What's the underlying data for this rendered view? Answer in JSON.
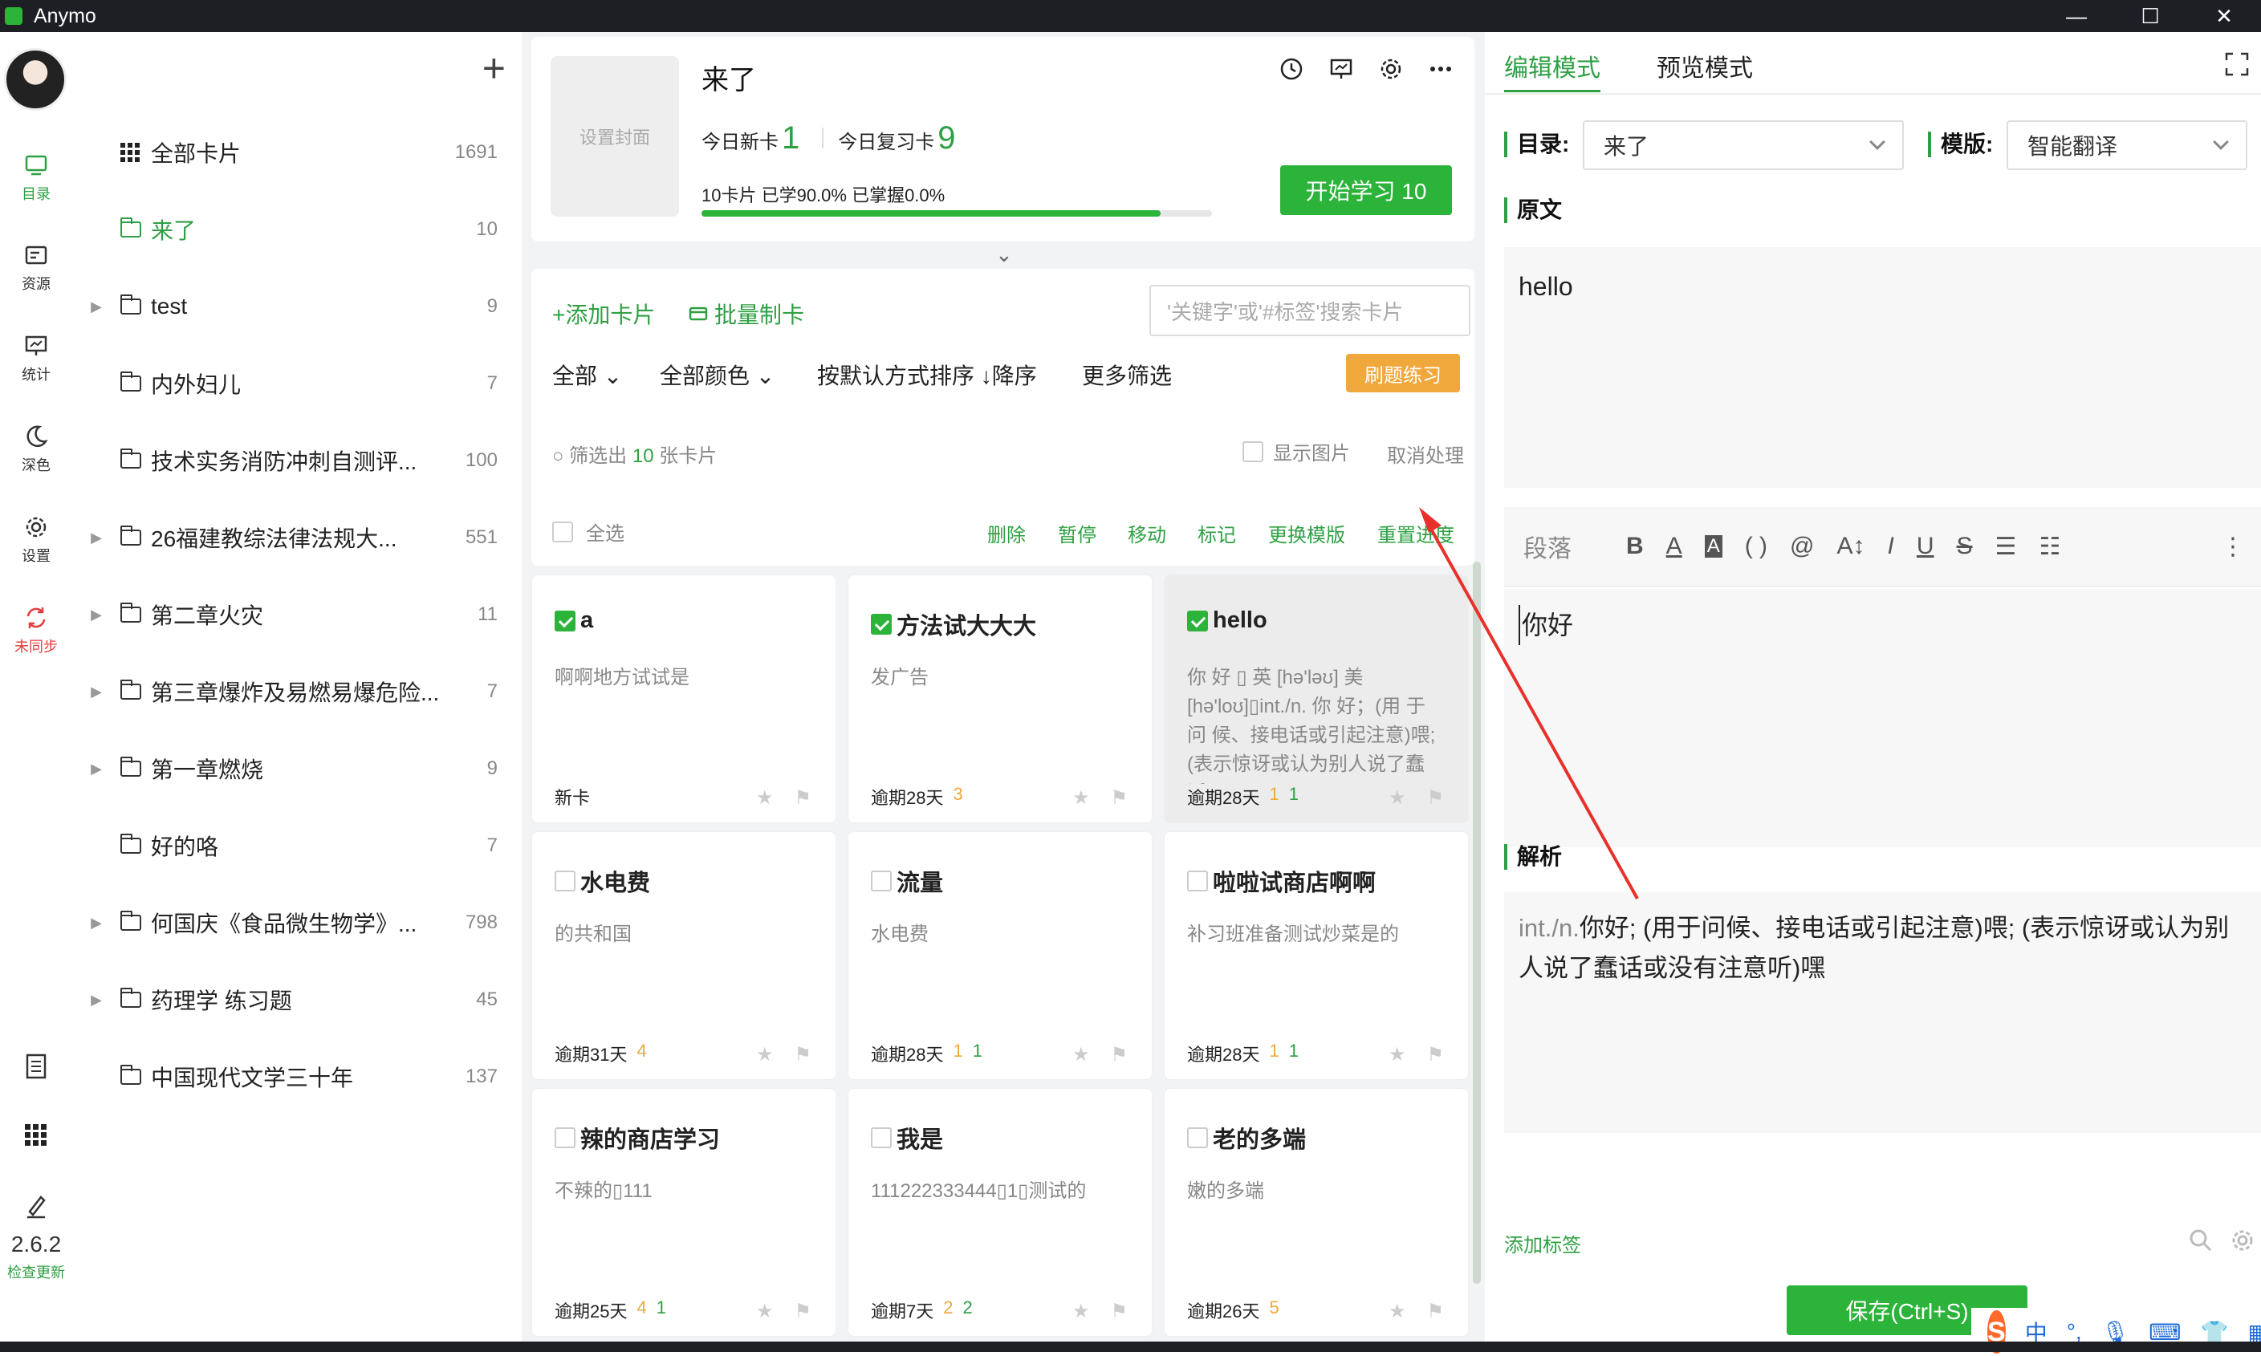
{
  "app": {
    "title": "Anymo"
  },
  "window": {
    "minimize": "—",
    "maximize": "☐",
    "close": "✕"
  },
  "rail": {
    "items": [
      {
        "label": "目录",
        "icon": "monitor-icon"
      },
      {
        "label": "资源",
        "icon": "resource-icon"
      },
      {
        "label": "统计",
        "icon": "chart-icon"
      },
      {
        "label": "深色",
        "icon": "moon-icon"
      },
      {
        "label": "设置",
        "icon": "gear-icon"
      },
      {
        "label": "未同步",
        "icon": "sync-icon"
      }
    ],
    "version": "2.6.2",
    "check_update": "检查更新"
  },
  "directory": {
    "add": "+",
    "all": {
      "name": "全部卡片",
      "count": "1691"
    },
    "items": [
      {
        "name": "来了",
        "count": "10",
        "active": true,
        "arrow": ""
      },
      {
        "name": "test",
        "count": "9",
        "arrow": "▶"
      },
      {
        "name": "内外妇儿",
        "count": "7",
        "arrow": ""
      },
      {
        "name": "技术实务消防冲刺自测评...",
        "count": "100",
        "arrow": ""
      },
      {
        "name": "26福建教综法律法规大...",
        "count": "551",
        "arrow": "▶"
      },
      {
        "name": "第二章火灾",
        "count": "11",
        "arrow": "▶"
      },
      {
        "name": "第三章爆炸及易燃易爆危险...",
        "count": "7",
        "arrow": "▶"
      },
      {
        "name": "第一章燃烧",
        "count": "9",
        "arrow": "▶"
      },
      {
        "name": "好的咯",
        "count": "7",
        "arrow": ""
      },
      {
        "name": "何国庆《食品微生物学》...",
        "count": "798",
        "arrow": "▶"
      },
      {
        "name": "药理学 练习题",
        "count": "45",
        "arrow": "▶"
      },
      {
        "name": "中国现代文学三十年",
        "count": "137",
        "arrow": ""
      }
    ]
  },
  "deck": {
    "cover": "设置封面",
    "title": "来了",
    "new_label": "今日新卡",
    "new_value": "1",
    "review_label": "今日复习卡",
    "review_value": "9",
    "progress_text": "10卡片   已学90.0%   已掌握0.0%",
    "progress": 0.9,
    "study_button": "开始学习 10"
  },
  "filters": {
    "add_card": "+添加卡片",
    "batch": "批量制卡",
    "search_placeholder": "'关键字'或'#标签'搜索卡片",
    "all": "全部",
    "colors": "全部颜色",
    "sort": "按默认方式排序 ↓降序",
    "more": "更多筛选",
    "practice": "刷题练习",
    "filtered_prefix": "筛选出",
    "filtered_count": "10",
    "filtered_suffix": "张卡片",
    "show_images": "显示图片",
    "cancel": "取消处理",
    "select_all": "全选",
    "actions": [
      "删除",
      "暂停",
      "移动",
      "标记",
      "更换模版",
      "重置进度"
    ]
  },
  "cards": [
    {
      "title": "a",
      "body": "啊啊地方试试是",
      "status": "新卡",
      "n1": "",
      "n2": "",
      "checked": true
    },
    {
      "title": "方法试大大大",
      "body": "发广告",
      "status": "逾期28天",
      "n1": "3",
      "n2": "",
      "checked": true
    },
    {
      "title": "hello",
      "body": "你 好 ▯ 英 [hə'ləʊ]      美 [hə'loʊ]▯int./n. 你 好；(用 于 问 候、接电话或引起注意)喂; (表示惊讶或认为别人说了蠢话...",
      "status": "逾期28天",
      "n1": "1",
      "n2": "1",
      "checked": true,
      "highlight": true
    },
    {
      "title": "水电费",
      "body": "的共和国",
      "status": "逾期31天",
      "n1": "4",
      "n2": "",
      "checked": false
    },
    {
      "title": "流量",
      "body": "水电费",
      "status": "逾期28天",
      "n1": "1",
      "n2": "1",
      "checked": false
    },
    {
      "title": "啦啦试商店啊啊",
      "body": "补习班准备测试炒菜是的",
      "status": "逾期28天",
      "n1": "1",
      "n2": "1",
      "checked": false
    },
    {
      "title": "辣的商店学习",
      "body": "不辣的▯111",
      "status": "逾期25天",
      "n1": "4",
      "n2": "1",
      "checked": false
    },
    {
      "title": "我是",
      "body": "111222333444▯1▯测试的",
      "status": "逾期7天",
      "n1": "2",
      "n2": "2",
      "checked": false
    },
    {
      "title": "老的多端",
      "body": "嫩的多端",
      "status": "逾期26天",
      "n1": "5",
      "n2": "",
      "checked": false
    }
  ],
  "editor": {
    "tab_edit": "编辑模式",
    "tab_preview": "预览模式",
    "dir_label": "目录:",
    "dir_value": "来了",
    "template_label": "模版:",
    "template_value": "智能翻译",
    "original_label": "原文",
    "original_text": "hello",
    "toolbar_para": "段落",
    "translation_text": "你好",
    "analysis_label": "解析",
    "analysis_prefix": "int./n.",
    "analysis_text": "你好; (用于问候、接电话或引起注意)喂; (表示惊讶或认为别人说了蠢话或没有注意听)嘿",
    "add_tag": "添加标签",
    "save": "保存(Ctrl+S)"
  },
  "ime": {
    "logo": "S",
    "lang": "中"
  },
  "colors": {
    "accent": "#2ea043",
    "button": "#2bb33a",
    "warning": "#f0a83c",
    "annotation": "#e8312a"
  }
}
